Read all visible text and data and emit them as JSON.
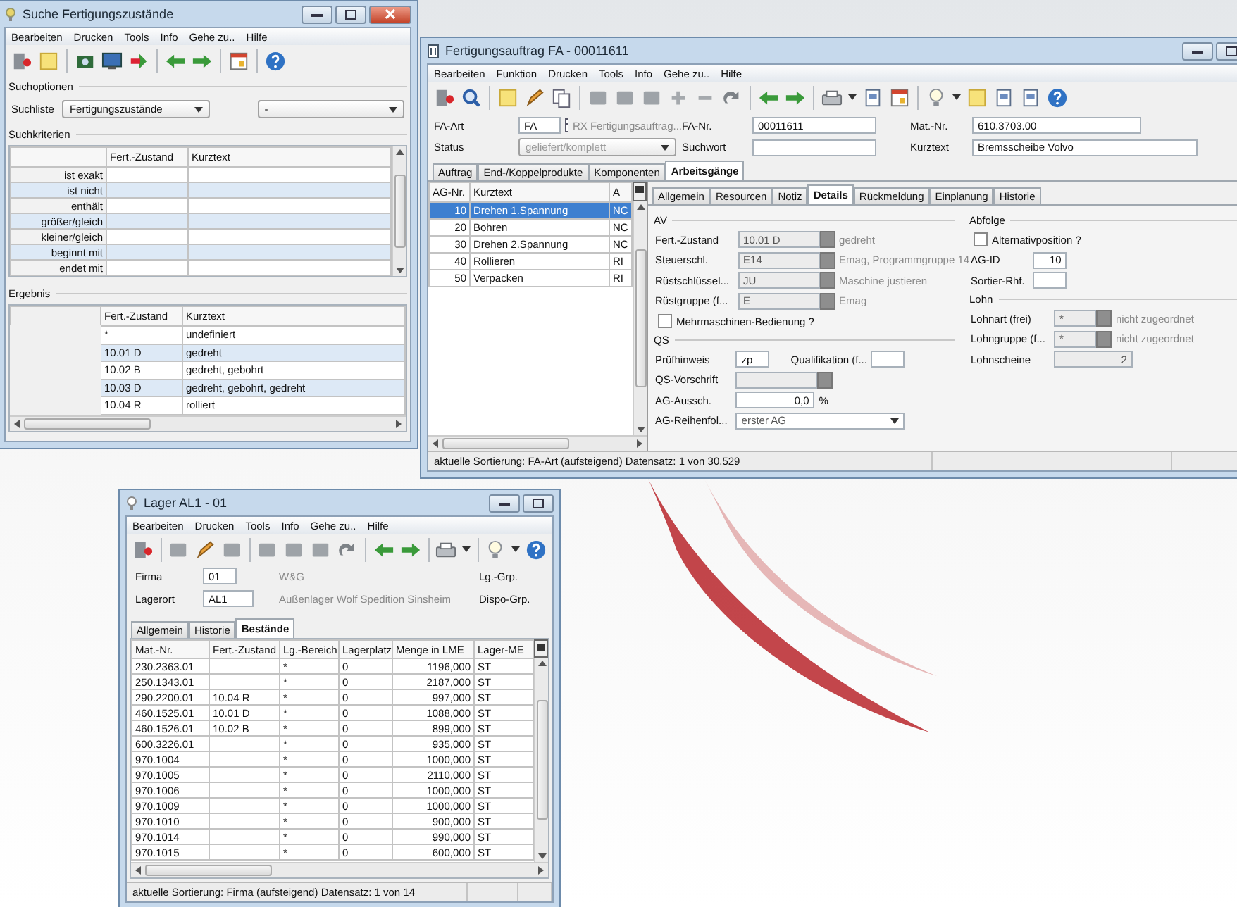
{
  "search_window": {
    "title": "Suche Fertigungszustände",
    "menu": [
      "Bearbeiten",
      "Drucken",
      "Tools",
      "Info",
      "Gehe zu..",
      "Hilfe"
    ],
    "options": {
      "heading": "Suchoptionen",
      "list_label": "Suchliste",
      "list_value": "Fertigungszustände",
      "filter_value": "-"
    },
    "criteria": {
      "heading": "Suchkriterien",
      "columns": [
        "Fert.-Zustand",
        "Kurztext"
      ],
      "rows": [
        "ist exakt",
        "ist nicht",
        "enthält",
        "größer/gleich",
        "kleiner/gleich",
        "beginnt mit",
        "endet mit"
      ]
    },
    "result": {
      "heading": "Ergebnis",
      "columns": [
        "Fert.-Zustand",
        "Kurztext"
      ],
      "rows": [
        [
          "*",
          "undefiniert"
        ],
        [
          "10.01 D",
          "gedreht"
        ],
        [
          "10.02 B",
          "gedreht, gebohrt"
        ],
        [
          "10.03 D",
          "gedreht, gebohrt, gedreht"
        ],
        [
          "10.04 R",
          "rolliert"
        ]
      ]
    }
  },
  "order_window": {
    "title": "Fertigungsauftrag FA - 00011611",
    "menu": [
      "Bearbeiten",
      "Funktion",
      "Drucken",
      "Tools",
      "Info",
      "Gehe zu..",
      "Hilfe"
    ],
    "header": {
      "fa_art": {
        "label": "FA-Art",
        "value": "FA",
        "description": "RX Fertigungsauftrag..."
      },
      "fa_nr": {
        "label": "FA-Nr.",
        "value": "00011611"
      },
      "mat_nr": {
        "label": "Mat.-Nr.",
        "value": "610.3703.00"
      },
      "status": {
        "label": "Status",
        "value": "geliefert/komplett",
        "disabled": true
      },
      "search": {
        "label": "Suchwort"
      },
      "short_text": {
        "label": "Kurztext",
        "value": "Bremsscheibe Volvo"
      }
    },
    "tabs": [
      {
        "label": "Auftrag",
        "selected": false
      },
      {
        "label": "End-/Koppelprodukte",
        "selected": false
      },
      {
        "label": "Komponenten",
        "selected": false
      },
      {
        "label": "Arbeitsgänge",
        "selected": true
      }
    ],
    "operations": {
      "columns": [
        "AG-Nr.",
        "Kurztext",
        "A"
      ],
      "rows": [
        {
          "cells": [
            "10",
            "Drehen 1.Spannung",
            "NC"
          ],
          "selected": true
        },
        {
          "cells": [
            "20",
            "Bohren",
            "NC"
          ],
          "selected": false
        },
        {
          "cells": [
            "30",
            "Drehen 2.Spannung",
            "NC"
          ],
          "selected": false
        },
        {
          "cells": [
            "40",
            "Rollieren",
            "RI"
          ],
          "selected": false
        },
        {
          "cells": [
            "50",
            "Verpacken",
            "RI"
          ],
          "selected": false
        }
      ]
    },
    "detail_tabs": [
      {
        "label": "Allgemein",
        "selected": false
      },
      {
        "label": "Resourcen",
        "selected": false
      },
      {
        "label": "Notiz",
        "selected": false
      },
      {
        "label": "Details",
        "selected": true
      },
      {
        "label": "Rückmeldung",
        "selected": false
      },
      {
        "label": "Einplanung",
        "selected": false
      },
      {
        "label": "Historie",
        "selected": false
      }
    ],
    "left_sections": [
      {
        "heading": "AV",
        "fields": [
          {
            "kind": "lookup",
            "label": "Fert.-Zustand",
            "value": "10.01 D",
            "description": "gedreht"
          },
          {
            "kind": "lookup",
            "label": "Steuerschl.",
            "value": "E14",
            "description": "Emag, Programmgruppe 14"
          },
          {
            "kind": "lookup",
            "label": "Rüstschlüssel...",
            "value": "JU",
            "description": "Maschine justieren"
          },
          {
            "kind": "lookup",
            "label": "Rüstgruppe (f...",
            "value": "E",
            "description": "Emag"
          },
          {
            "kind": "checkbox",
            "label": "Mehrmaschinen-Bedienung ?",
            "checked": false
          }
        ]
      },
      {
        "heading": "QS",
        "fields": [
          {
            "kind": "pair",
            "label": "Prüfhinweis",
            "value": "zp",
            "second_label": "Qualifikation (f..."
          },
          {
            "kind": "lookup",
            "label": "QS-Vorschrift"
          },
          {
            "kind": "number",
            "label": "AG-Aussch.",
            "value": "0,0",
            "unit": "%"
          },
          {
            "kind": "dropdown",
            "label": "AG-Reihenfol...",
            "value": "erster AG"
          }
        ]
      }
    ],
    "right_sections": [
      {
        "heading": "Abfolge",
        "fields": [
          {
            "kind": "checkbox",
            "label": "Alternativposition ?",
            "checked": false
          },
          {
            "kind": "text",
            "label": "AG-ID",
            "value": "10"
          },
          {
            "kind": "text",
            "label": "Sortier-Rhf."
          }
        ]
      },
      {
        "heading": "Lohn",
        "fields": [
          {
            "kind": "lookup",
            "label": "Lohnart (frei)",
            "value": "*",
            "description": "nicht zugeordnet"
          },
          {
            "kind": "lookup",
            "label": "Lohngruppe (f...",
            "value": "*",
            "description": "nicht zugeordnet"
          },
          {
            "kind": "number",
            "label": "Lohnscheine",
            "value": "2"
          }
        ]
      }
    ],
    "status_bar": "aktuelle Sortierung: FA-Art (aufsteigend) Datensatz: 1 von 30.529"
  },
  "stock_window": {
    "title": "Lager AL1 - 01",
    "menu": [
      "Bearbeiten",
      "Drucken",
      "Tools",
      "Info",
      "Gehe zu..",
      "Hilfe"
    ],
    "firma": {
      "label": "Firma",
      "value": "01",
      "description": "W&G"
    },
    "location": {
      "label": "Lagerort",
      "value": "AL1",
      "description": "Außenlager Wolf Spedition Sinsheim"
    },
    "group_labels": [
      "Lg.-Grp.",
      "Dispo-Grp."
    ],
    "tabs": [
      {
        "label": "Allgemein",
        "selected": false
      },
      {
        "label": "Historie",
        "selected": false
      },
      {
        "label": "Bestände",
        "selected": true
      }
    ],
    "table": {
      "columns": [
        "Mat.-Nr.",
        "Fert.-Zustand",
        "Lg.-Bereich",
        "Lagerplatz",
        "Menge in LME",
        "Lager-ME"
      ],
      "rows": [
        [
          "230.2363.01",
          "",
          "*",
          "0",
          "1196,000",
          "ST"
        ],
        [
          "250.1343.01",
          "",
          "*",
          "0",
          "2187,000",
          "ST"
        ],
        [
          "290.2200.01",
          "10.04 R",
          "*",
          "0",
          "997,000",
          "ST"
        ],
        [
          "460.1525.01",
          "10.01 D",
          "*",
          "0",
          "1088,000",
          "ST"
        ],
        [
          "460.1526.01",
          "10.02 B",
          "*",
          "0",
          "899,000",
          "ST"
        ],
        [
          "600.3226.01",
          "",
          "*",
          "0",
          "935,000",
          "ST"
        ],
        [
          "970.1004",
          "",
          "*",
          "0",
          "1000,000",
          "ST"
        ],
        [
          "970.1005",
          "",
          "*",
          "0",
          "2110,000",
          "ST"
        ],
        [
          "970.1006",
          "",
          "*",
          "0",
          "1000,000",
          "ST"
        ],
        [
          "970.1009",
          "",
          "*",
          "0",
          "1000,000",
          "ST"
        ],
        [
          "970.1010",
          "",
          "*",
          "0",
          "900,000",
          "ST"
        ],
        [
          "970.1014",
          "",
          "*",
          "0",
          "990,000",
          "ST"
        ],
        [
          "970.1015",
          "",
          "*",
          "0",
          "600,000",
          "ST"
        ]
      ]
    },
    "status_bar": "aktuelle Sortierung: Firma (aufsteigend) Datensatz: 1 von 14"
  }
}
